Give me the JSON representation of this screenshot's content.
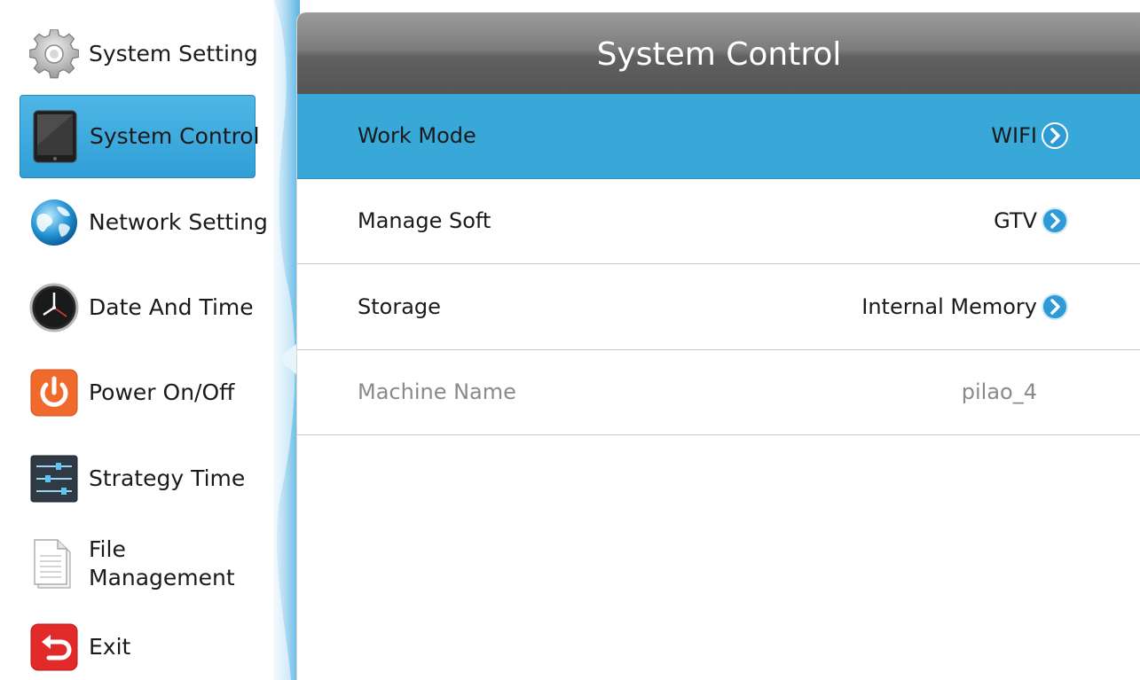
{
  "sidebar": {
    "items": [
      {
        "label": "System Setting",
        "icon": "gear-icon",
        "active": false
      },
      {
        "label": "System Control",
        "icon": "tablet-icon",
        "active": true
      },
      {
        "label": "Network Setting",
        "icon": "globe-icon",
        "active": false
      },
      {
        "label": "Date And Time",
        "icon": "clock-icon",
        "active": false
      },
      {
        "label": "Power On/Off",
        "icon": "power-icon",
        "active": false
      },
      {
        "label": "Strategy Time",
        "icon": "sliders-icon",
        "active": false
      },
      {
        "label": "File Management",
        "icon": "document-icon",
        "active": false
      },
      {
        "label": "Exit",
        "icon": "exit-icon",
        "active": false
      }
    ]
  },
  "main": {
    "title": "System Control",
    "rows": [
      {
        "label": "Work Mode",
        "value": "WIFI",
        "selected": true,
        "enabled": true
      },
      {
        "label": "Manage Soft",
        "value": "GTV",
        "selected": false,
        "enabled": true
      },
      {
        "label": "Storage",
        "value": "Internal Memory",
        "selected": false,
        "enabled": true
      },
      {
        "label": "Machine Name",
        "value": "pilao_4",
        "selected": false,
        "enabled": false
      }
    ]
  },
  "colors": {
    "accent": "#38a8d8",
    "header": "#6e6e6e",
    "chevron": "#2e9ad6",
    "power": "#f06a2c",
    "exit": "#e22a2a"
  }
}
